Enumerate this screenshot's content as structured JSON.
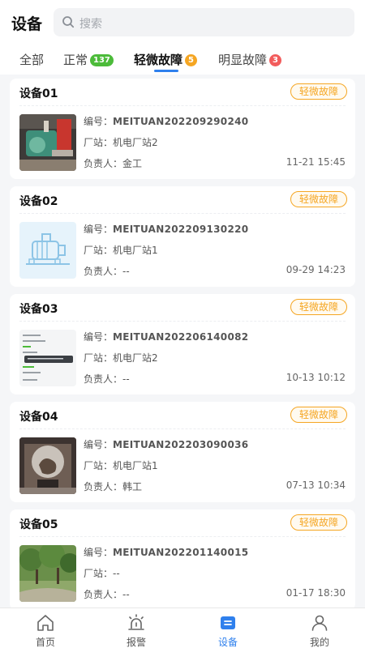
{
  "header": {
    "title": "设备",
    "search_placeholder": "搜索"
  },
  "tabs": [
    {
      "label": "全部",
      "count": null,
      "badge_color": null,
      "active": false
    },
    {
      "label": "正常",
      "count": "137",
      "badge_color": "#4cbb3a",
      "active": false
    },
    {
      "label": "轻微故障",
      "count": "5",
      "badge_color": "#f5a623",
      "active": true
    },
    {
      "label": "明显故障",
      "count": "3",
      "badge_color": "#f25c5c",
      "active": false
    }
  ],
  "field_labels": {
    "code": "编号：",
    "station": "厂站：",
    "owner": "负责人："
  },
  "devices": [
    {
      "name": "设备01",
      "status": "轻微故障",
      "code": "MEITUAN202209290240",
      "station": "机电厂站2",
      "owner": "金工",
      "time": "11-21 15:45",
      "image": "machine-photo"
    },
    {
      "name": "设备02",
      "status": "轻微故障",
      "code": "MEITUAN202209130220",
      "station": "机电厂站1",
      "owner": "--",
      "time": "09-29 14:23",
      "image": "motor-illustration"
    },
    {
      "name": "设备03",
      "status": "轻微故障",
      "code": "MEITUAN202206140082",
      "station": "机电厂站2",
      "owner": "--",
      "time": "10-13 10:12",
      "image": "document-screenshot"
    },
    {
      "name": "设备04",
      "status": "轻微故障",
      "code": "MEITUAN202203090036",
      "station": "机电厂站1",
      "owner": "韩工",
      "time": "07-13 10:34",
      "image": "sculpture-photo"
    },
    {
      "name": "设备05",
      "status": "轻微故障",
      "code": "MEITUAN202201140015",
      "station": "--",
      "owner": "--",
      "time": "01-17 18:30",
      "image": "park-photo"
    }
  ],
  "bottom_nav": [
    {
      "label": "首页",
      "icon": "home-icon",
      "active": false
    },
    {
      "label": "报警",
      "icon": "alarm-icon",
      "active": false
    },
    {
      "label": "设备",
      "icon": "device-icon",
      "active": true
    },
    {
      "label": "我的",
      "icon": "profile-icon",
      "active": false
    }
  ],
  "colors": {
    "accent": "#2f80ed",
    "warning": "#f5a623",
    "normal": "#4cbb3a",
    "fault": "#f25c5c"
  }
}
